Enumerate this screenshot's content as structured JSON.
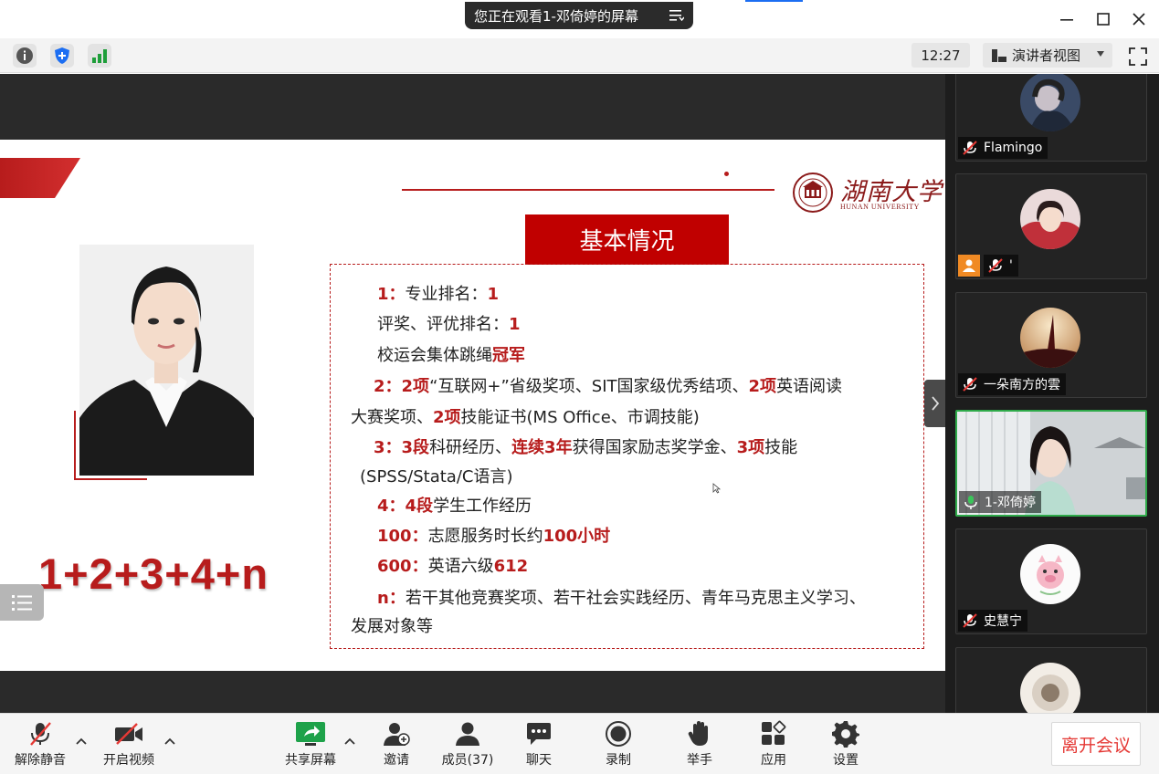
{
  "titlebar": {
    "sharing_notice": "您正在观看1-邓倚婷的屏幕"
  },
  "toolbar": {
    "time": "12:27",
    "view_mode": "演讲者视图"
  },
  "slide": {
    "logo_name": "湖南大学",
    "logo_sub": "HUNAN UNIVERSITY",
    "title": "基本情况",
    "formula": "1+2+3+4+n",
    "lines": {
      "l1a": "1：",
      "l1b": "专业排名：",
      "l1c": "1",
      "l2a": "评奖、评优排名：",
      "l2b": "1",
      "l3a": "校运会集体跳绳",
      "l3b": "冠军",
      "l4a": "2：",
      "l4b": "2项",
      "l4c": "“互联网+”省级奖项、SIT国家级优秀结项、",
      "l4d": "2项",
      "l4e": "英语阅读",
      "l5a": "大赛奖项、",
      "l5b": "2项",
      "l5c": "技能证书(MS Office、市调技能)",
      "l6a": "3：",
      "l6b": "3段",
      "l6c": "科研经历、",
      "l6d": "连续3年",
      "l6e": "获得国家励志奖学金、",
      "l6f": "3项",
      "l6g": "技能",
      "l7a": "(SPSS/Stata/C语言)",
      "l8a": "4：",
      "l8b": "4段",
      "l8c": "学生工作经历",
      "l9a": "100：",
      "l9b": "志愿服务时长约",
      "l9c": "100小时",
      "l10a": "600：",
      "l10b": "英语六级",
      "l10c": "612",
      "l11a": "n：",
      "l11b": "若干其他竞赛奖项、若干社会实践经历、青年马克思主义学习、",
      "l12a": "发展对象等"
    }
  },
  "participants": [
    {
      "name": "Flamingo",
      "muted": true
    },
    {
      "name": "'",
      "muted": true
    },
    {
      "name": "一朵南方的雲",
      "muted": true
    },
    {
      "name": "1-邓倚婷",
      "muted": false,
      "speaking": true
    },
    {
      "name": "史慧宁",
      "muted": true
    }
  ],
  "bottombar": {
    "unmute": "解除静音",
    "video": "开启视频",
    "share": "共享屏幕",
    "invite": "邀请",
    "members": "成员(37)",
    "chat": "聊天",
    "record": "录制",
    "raise_hand": "举手",
    "apps": "应用",
    "settings": "设置",
    "leave": "离开会议"
  },
  "colors": {
    "brand_red": "#b71c1c",
    "title_red": "#c00000",
    "leave_red": "#e53935",
    "active_green": "#2faa4a",
    "shield_blue": "#1c6ef2"
  }
}
